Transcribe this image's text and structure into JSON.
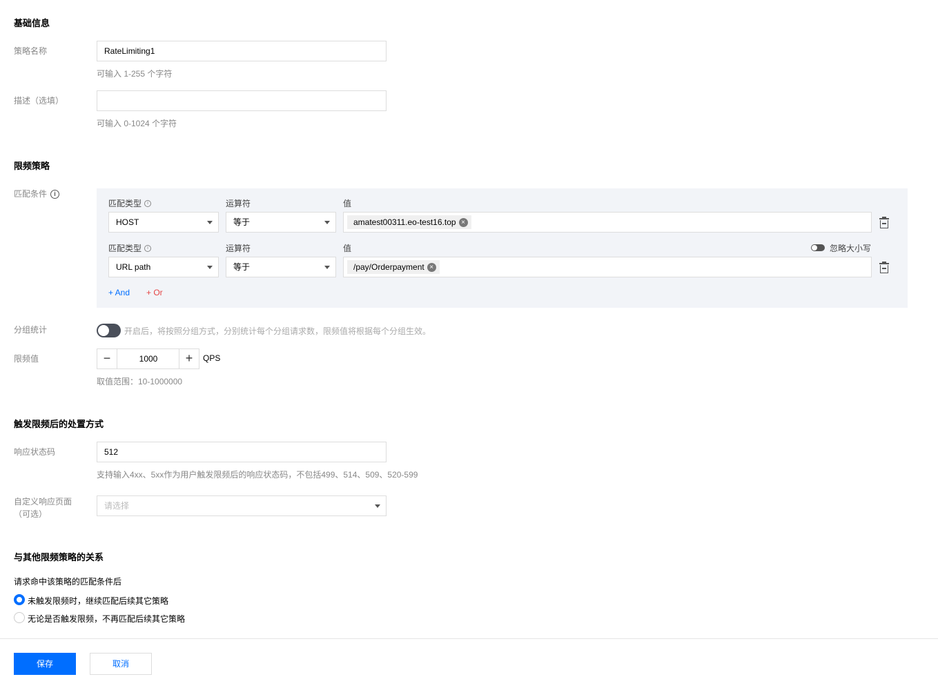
{
  "basic": {
    "title": "基础信息",
    "name_label": "策略名称",
    "name_value": "RateLimiting1",
    "name_hint": "可输入 1-255 个字符",
    "desc_label": "描述（选填）",
    "desc_value": "",
    "desc_hint": "可输入 0-1024 个字符"
  },
  "limit": {
    "title": "限频策略",
    "match_label": "匹配条件",
    "conditions": [
      {
        "type_label": "匹配类型",
        "op_label": "运算符",
        "value_label": "值",
        "type": "HOST",
        "op": "等于",
        "tag": "amatest00311.eo-test16.top"
      },
      {
        "type_label": "匹配类型",
        "op_label": "运算符",
        "value_label": "值",
        "type": "URL path",
        "op": "等于",
        "tag": "/pay/Orderpayment",
        "ignore_case_label": "忽略大小写"
      }
    ],
    "and_label": "+ And",
    "or_label": "+ Or",
    "group_label": "分组统计",
    "group_desc": "开启后，将按照分组方式，分别统计每个分组请求数，限频值将根据每个分组生效。",
    "rate_label": "限频值",
    "rate_value": "1000",
    "rate_unit": "QPS",
    "rate_hint": "取值范围：10-1000000"
  },
  "action": {
    "title": "触发限频后的处置方式",
    "code_label": "响应状态码",
    "code_value": "512",
    "code_hint": "支持输入4xx、5xx作为用户触发限频后的响应状态码，不包括499、514、509、520-599",
    "page_label_1": "自定义响应页面",
    "page_label_2": "（可选）",
    "page_placeholder": "请选择"
  },
  "relation": {
    "title": "与其他限频策略的关系",
    "question": "请求命中该策略的匹配条件后",
    "options": [
      "未触发限频时，继续匹配后续其它策略",
      "无论是否触发限频，不再匹配后续其它策略"
    ]
  },
  "footer": {
    "save": "保存",
    "cancel": "取消"
  },
  "colors": {
    "primary": "#006eff",
    "or": "#e54545"
  }
}
